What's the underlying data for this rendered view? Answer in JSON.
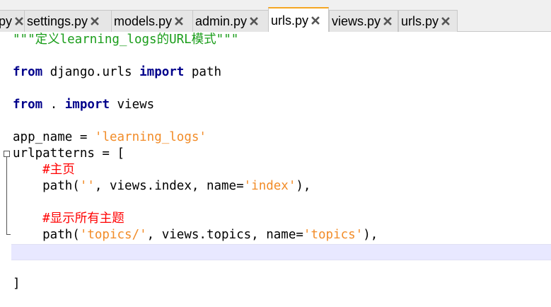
{
  "colors": {
    "keyword": "#00008b",
    "string": "#f28c28",
    "comment": "#ff0000",
    "docstring": "#1a9d1a",
    "active_tab_accent": "#f5a623",
    "current_line": "#e8e8ff"
  },
  "tabs": [
    {
      "label": "py",
      "active": false,
      "icon": "close-icon"
    },
    {
      "label": "settings.py",
      "active": false,
      "icon": "close-icon"
    },
    {
      "label": "models.py",
      "active": false,
      "icon": "close-icon"
    },
    {
      "label": "admin.py",
      "active": false,
      "icon": "close-icon"
    },
    {
      "label": "urls.py",
      "active": true,
      "icon": "close-icon"
    },
    {
      "label": "views.py",
      "active": false,
      "icon": "close-icon"
    },
    {
      "label": "urls.py",
      "active": false,
      "icon": "close-icon"
    }
  ],
  "editor": {
    "lines": [
      {
        "tokens": [
          {
            "t": "\"\"\"定义learning_logs的URL模式\"\"\"",
            "c": "doc"
          }
        ]
      },
      {
        "tokens": []
      },
      {
        "tokens": [
          {
            "t": "from",
            "c": "kw"
          },
          {
            "t": " django.urls ",
            "c": "op"
          },
          {
            "t": "import",
            "c": "kw"
          },
          {
            "t": " path",
            "c": "op"
          }
        ]
      },
      {
        "tokens": []
      },
      {
        "tokens": [
          {
            "t": "from",
            "c": "kw"
          },
          {
            "t": " . ",
            "c": "op"
          },
          {
            "t": "import",
            "c": "kw"
          },
          {
            "t": " views",
            "c": "op"
          }
        ]
      },
      {
        "tokens": []
      },
      {
        "tokens": [
          {
            "t": "app_name = ",
            "c": "op"
          },
          {
            "t": "'learning_logs'",
            "c": "str"
          }
        ]
      },
      {
        "tokens": [
          {
            "t": "urlpatterns = [",
            "c": "op"
          }
        ]
      },
      {
        "tokens": [
          {
            "t": "    ",
            "c": "op"
          },
          {
            "t": "#主页",
            "c": "cmt"
          }
        ]
      },
      {
        "tokens": [
          {
            "t": "    path(",
            "c": "op"
          },
          {
            "t": "''",
            "c": "str"
          },
          {
            "t": ", views.index, name=",
            "c": "op"
          },
          {
            "t": "'index'",
            "c": "str"
          },
          {
            "t": "),",
            "c": "op"
          }
        ]
      },
      {
        "tokens": []
      },
      {
        "tokens": [
          {
            "t": "    ",
            "c": "op"
          },
          {
            "t": "#显示所有主题",
            "c": "cmt"
          }
        ]
      },
      {
        "tokens": [
          {
            "t": "    path(",
            "c": "op"
          },
          {
            "t": "'topics/'",
            "c": "str"
          },
          {
            "t": ", views.topics, name=",
            "c": "op"
          },
          {
            "t": "'topics'",
            "c": "str"
          },
          {
            "t": "),",
            "c": "op"
          }
        ]
      },
      {
        "tokens": []
      },
      {
        "tokens": []
      },
      {
        "tokens": [
          {
            "t": "]",
            "c": "op"
          }
        ]
      }
    ]
  }
}
